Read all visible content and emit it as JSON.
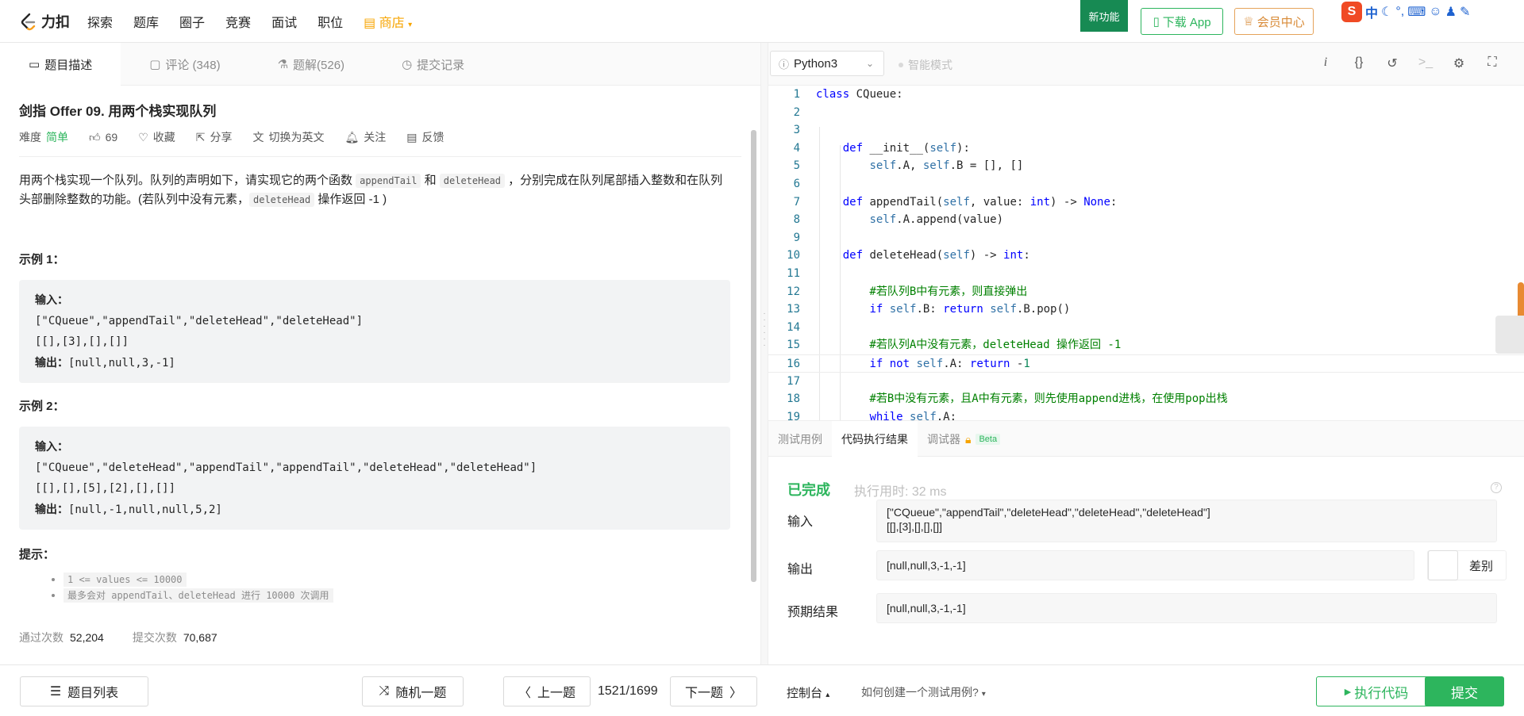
{
  "nav": {
    "logo_text": "力扣",
    "items": [
      "探索",
      "题库",
      "圈子",
      "竞赛",
      "面试",
      "职位"
    ],
    "shop": "商店",
    "new_feature": "新功能",
    "download_app": "下载 App",
    "member_center": "会员中心",
    "ime_lang": "中"
  },
  "left_tabs": [
    {
      "label": "题目描述"
    },
    {
      "label": "评论 (348)"
    },
    {
      "label": "题解(526)"
    },
    {
      "label": "提交记录"
    }
  ],
  "problem": {
    "title": "剑指 Offer 09. 用两个栈实现队列",
    "difficulty_label": "难度",
    "difficulty": "简单",
    "likes": "69",
    "favorite": "收藏",
    "share": "分享",
    "switch_lang": "切换为英文",
    "follow": "关注",
    "feedback": "反馈",
    "desc_1": "用两个栈实现一个队列。队列的声明如下，请实现它的两个函数 ",
    "desc_code1": "appendTail",
    "desc_2": " 和 ",
    "desc_code2": "deleteHead",
    "desc_3": " ，分别完成在队列尾部插入整数和在队列头部删除整数的功能。(若队列中没有元素，",
    "desc_code3": "deleteHead",
    "desc_4": " 操作返回 -1 )",
    "example1_title": "示例 1：",
    "example1": {
      "input_label": "输入：",
      "input_line1": "[\"CQueue\",\"appendTail\",\"deleteHead\",\"deleteHead\"]",
      "input_line2": "[[],[3],[],[]]",
      "output_label": "输出：",
      "output": "[null,null,3,-1]"
    },
    "example2_title": "示例 2：",
    "example2": {
      "input_label": "输入：",
      "input_line1": "[\"CQueue\",\"deleteHead\",\"appendTail\",\"appendTail\",\"deleteHead\",\"deleteHead\"]",
      "input_line2": "[[],[],[5],[2],[],[]]",
      "output_label": "输出：",
      "output": "[null,-1,null,null,5,2]"
    },
    "hints_title": "提示：",
    "hint1": "1 <= values <= 10000",
    "hint2_pre": "最多会对 ",
    "hint2_code": "appendTail、deleteHead",
    "hint2_mid": " 进行 ",
    "hint2_code2": "10000",
    "hint2_post": " 次调用",
    "pass_label": "通过次数",
    "pass_count": "52,204",
    "submit_label": "提交次数",
    "submit_count": "70,687"
  },
  "editor": {
    "language": "Python3",
    "smart_mode": "智能模式"
  },
  "code_lines": [
    {
      "n": "1",
      "t": "class CQueue:"
    },
    {
      "n": "2",
      "t": ""
    },
    {
      "n": "3",
      "t": ""
    },
    {
      "n": "4",
      "t": "    def __init__(self):"
    },
    {
      "n": "5",
      "t": "        self.A, self.B = [], []"
    },
    {
      "n": "6",
      "t": ""
    },
    {
      "n": "7",
      "t": "    def appendTail(self, value: int) -> None:"
    },
    {
      "n": "8",
      "t": "        self.A.append(value)"
    },
    {
      "n": "9",
      "t": ""
    },
    {
      "n": "10",
      "t": "    def deleteHead(self) -> int:"
    },
    {
      "n": "11",
      "t": ""
    },
    {
      "n": "12",
      "t": "        #若队列B中有元素，则直接弹出"
    },
    {
      "n": "13",
      "t": "        if self.B: return self.B.pop()"
    },
    {
      "n": "14",
      "t": ""
    },
    {
      "n": "15",
      "t": "        #若队列A中没有元素，deleteHead 操作返回 -1"
    },
    {
      "n": "16",
      "t": "        if not self.A: return -1"
    },
    {
      "n": "17",
      "t": ""
    },
    {
      "n": "18",
      "t": "        #若B中没有元素，且A中有元素，则先使用append进栈，在使用pop出栈"
    },
    {
      "n": "19",
      "t": "        while self.A:"
    }
  ],
  "bottom_tabs": [
    {
      "label": "测试用例"
    },
    {
      "label": "代码执行结果"
    },
    {
      "label": "调试器"
    }
  ],
  "beta": "Beta",
  "result": {
    "status": "已完成",
    "time": "执行用时: 32 ms",
    "input_label": "输入",
    "input_line1": "[\"CQueue\",\"appendTail\",\"deleteHead\",\"deleteHead\",\"deleteHead\"]",
    "input_line2": "[[],[3],[],[],[]]",
    "output_label": "输出",
    "output": "[null,null,3,-1,-1]",
    "diff": "差别",
    "expected_label": "预期结果",
    "expected": "[null,null,3,-1,-1]"
  },
  "footer": {
    "problem_list": "题目列表",
    "random": "随机一题",
    "prev": "上一题",
    "counter": "1521/1699",
    "next": "下一题",
    "console": "控制台",
    "howto": "如何创建一个测试用例?",
    "run": "执行代码",
    "submit": "提交"
  }
}
